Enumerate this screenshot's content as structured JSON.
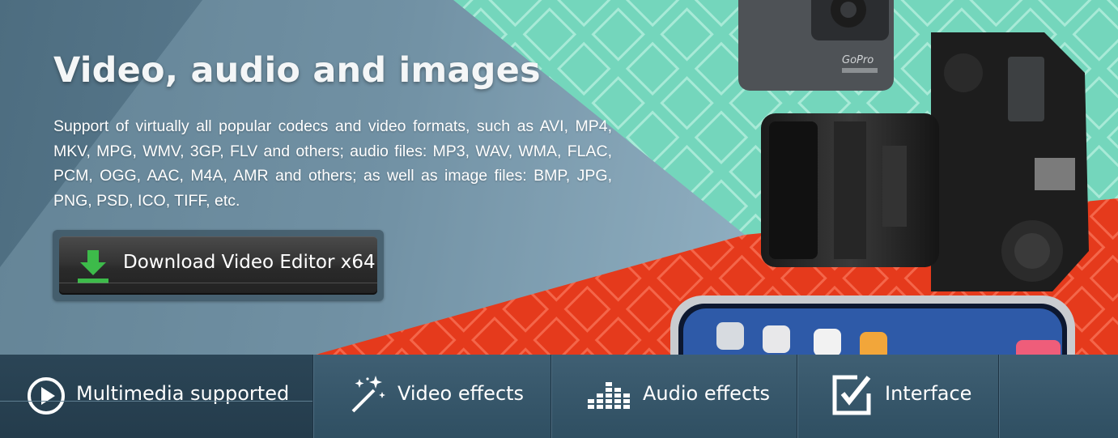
{
  "hero": {
    "title": "Video, audio and images",
    "description": "Support of virtually all popular codecs and video formats, such as AVI, MP4, MKV, MPG, WMV, 3GP, FLV and others; audio files: MP3, WAV, WMA, FLAC, PCM, OGG, AAC, M4A, AMR and others; as well as image files: BMP, JPG, PNG, PSD, ICO, TIFF, etc.",
    "download_button": {
      "label": "Download Video Editor x64",
      "icon": "download-arrow-icon",
      "icon_color": "#3dbb4a"
    },
    "camera_brand": "GoPro",
    "background_colors": {
      "teal_band": "#6fd3b8",
      "red_band": "#e2391d",
      "base": "#5a7a8e"
    }
  },
  "tabs": [
    {
      "label": "Multimedia supported",
      "icon": "play-circle-icon",
      "active": true
    },
    {
      "label": "Video effects",
      "icon": "magic-wand-icon",
      "active": false
    },
    {
      "label": "Audio effects",
      "icon": "equalizer-icon",
      "active": false
    },
    {
      "label": "Interface",
      "icon": "edit-checkbox-icon",
      "active": false
    }
  ]
}
